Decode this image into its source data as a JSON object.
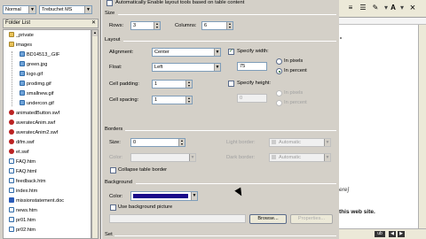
{
  "app": {
    "style_combo": "Normal",
    "font_combo": "Trebuchet MS",
    "folder_list_label": "Folder List",
    "tree": [
      {
        "label": "_private",
        "icon": "folder-icon",
        "kind": "folder"
      },
      {
        "label": "images",
        "icon": "folder-icon",
        "kind": "folder"
      },
      {
        "label": "BD14513_.GIF",
        "icon": "image-file-icon",
        "kind": "img"
      },
      {
        "label": "green.jpg",
        "icon": "image-file-icon",
        "kind": "img"
      },
      {
        "label": "logo.gif",
        "icon": "image-file-icon",
        "kind": "img"
      },
      {
        "label": "prodimg.gif",
        "icon": "image-file-icon",
        "kind": "img"
      },
      {
        "label": "smallnew.gif",
        "icon": "image-file-icon",
        "kind": "img"
      },
      {
        "label": "undercon.gif",
        "icon": "image-file-icon",
        "kind": "img"
      },
      {
        "label": "animatedButton.swf",
        "icon": "flash-file-icon",
        "kind": "swf"
      },
      {
        "label": "averatecAnim.swf",
        "icon": "flash-file-icon",
        "kind": "swf"
      },
      {
        "label": "averatecAnim2.swf",
        "icon": "flash-file-icon",
        "kind": "swf"
      },
      {
        "label": "difm.swf",
        "icon": "flash-file-icon",
        "kind": "swf"
      },
      {
        "label": "et.swf",
        "icon": "flash-file-icon",
        "kind": "swf"
      },
      {
        "label": "FAQ.htm",
        "icon": "html-file-icon",
        "kind": "htm"
      },
      {
        "label": "FAQ.html",
        "icon": "html-file-icon",
        "kind": "htm"
      },
      {
        "label": "feedback.htm",
        "icon": "html-file-icon",
        "kind": "htm"
      },
      {
        "label": "index.htm",
        "icon": "html-file-icon",
        "kind": "htm"
      },
      {
        "label": "missionstatement.doc",
        "icon": "word-file-icon",
        "kind": "doc"
      },
      {
        "label": "news.htm",
        "icon": "html-file-icon",
        "kind": "htm"
      },
      {
        "label": "pr01.htm",
        "icon": "html-file-icon",
        "kind": "htm"
      },
      {
        "label": "pr02.htm",
        "icon": "html-file-icon",
        "kind": "htm"
      }
    ]
  },
  "dialog": {
    "top_checkbox_label": "Automatically Enable layout tools based on table content",
    "size_group": "Size",
    "rows_label": "Rows:",
    "rows_value": "3",
    "columns_label": "Columns:",
    "columns_value": "6",
    "layout_group": "Layout",
    "alignment_label": "Alignment:",
    "alignment_value": "Center",
    "float_label": "Float:",
    "float_value": "Left",
    "cell_padding_label": "Cell padding:",
    "cell_padding_value": "1",
    "cell_spacing_label": "Cell spacing:",
    "cell_spacing_value": "1",
    "specify_width_label": "Specify width:",
    "width_value": "75",
    "in_pixels_label": "In pixels",
    "in_percent_label": "In percent",
    "specify_height_label": "Specify height:",
    "height_value": "0",
    "height_in_pixels_label": "In pixels",
    "height_in_percent_label": "In percent",
    "borders_group": "Borders",
    "border_size_label": "Size:",
    "border_size_value": "0",
    "border_color_label": "Color:",
    "light_border_label": "Light border:",
    "light_border_value": "Automatic",
    "dark_border_label": "Dark border:",
    "dark_border_value": "Automatic",
    "collapse_border_label": "Collapse table border",
    "background_group": "Background",
    "bg_color_label": "Color:",
    "bg_color_hex": "#1a0a8a",
    "use_bg_picture_label": "Use background picture",
    "browse_label": "Browse...",
    "properties_label": "Properties...",
    "set_group": "Set"
  },
  "doc": {
    "bracket_text": "ere]",
    "body_text": "this web site.",
    "bottom_button": "ub"
  }
}
